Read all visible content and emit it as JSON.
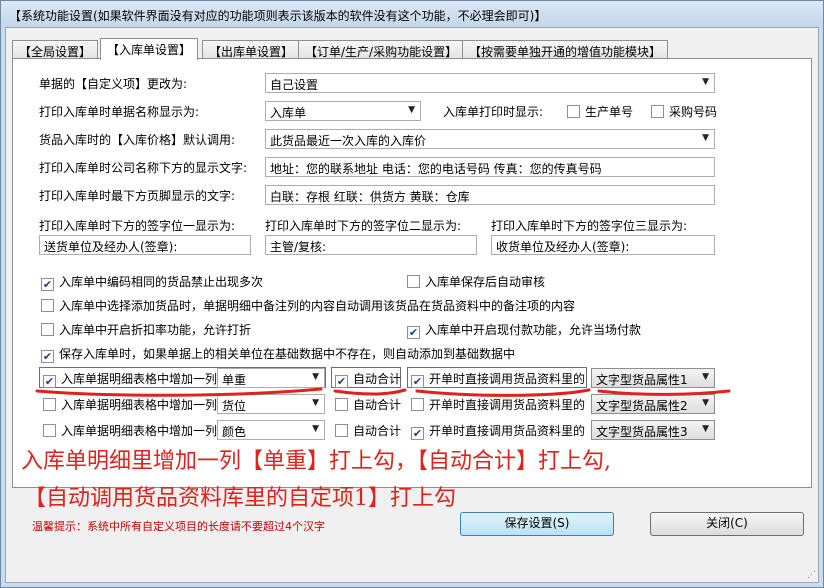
{
  "window": {
    "title": "【系统功能设置(如果软件界面没有对应的功能项则表示该版本的软件没有这个功能，不必理会即可)】"
  },
  "tabs": [
    {
      "label": "【全局设置】"
    },
    {
      "label": "【入库单设置】"
    },
    {
      "label": "【出库单设置】"
    },
    {
      "label": "【订单/生产/采购功能设置】"
    },
    {
      "label": "【按需要单独开通的增值功能模块】"
    }
  ],
  "form": {
    "custom_item_label": "单据的【自定义项】更改为:",
    "custom_item_value": "自己设置",
    "doc_name_label": "打印入库单时单据名称显示为:",
    "doc_name_value": "入库单",
    "print_show_label": "入库单打印时显示:",
    "production_no_label": "生产单号",
    "purchase_no_label": "采购号码",
    "price_default_label": "货品入库时的【入库价格】默认调用:",
    "price_default_value": "此货品最近一次入库的入库价",
    "company_text_label": "打印入库单时公司名称下方的显示文字:",
    "company_text_value": "地址：您的联系地址 电话：您的电话号码 传真：您的传真号码",
    "footer_text_label": "打印入库单时最下方页脚显示的文字:",
    "footer_text_value": "白联：存根   红联：供货方   黄联：仓库",
    "sign1_label": "打印入库单时下方的签字位一显示为:",
    "sign1_value": "送货单位及经办人(签章):",
    "sign2_label": "打印入库单时下方的签字位二显示为:",
    "sign2_value": "主管/复核:",
    "sign3_label": "打印入库单时下方的签字位三显示为:",
    "sign3_value": "收货单位及经办人(签章):"
  },
  "options": [
    {
      "label": "入库单中编码相同的货品禁止出现多次",
      "checked": true
    },
    {
      "label": "入库单保存后自动审核",
      "checked": false
    },
    {
      "label": "入库单中选择添加货品时，单据明细中备注列的内容自动调用该货品在货品资料中的备注项的内容",
      "checked": false
    },
    {
      "label": "入库单中开启折扣率功能，允许打折",
      "checked": false
    },
    {
      "label": "入库单中开启现付款功能，允许当场付款",
      "checked": true
    },
    {
      "label": "保存入库单时，如果单据上的相关单位在基础数据中不存在，则自动添加到基础数据中",
      "checked": true
    }
  ],
  "extra_columns": [
    {
      "label": "入库单据明细表格中增加一列",
      "checked": true,
      "column": "单重",
      "auto_sum_label": "自动合计",
      "auto_sum": true,
      "direct_label": "开单时直接调用货品资料里的",
      "direct": true,
      "attribute": "文字型货品属性1"
    },
    {
      "label": "入库单据明细表格中增加一列",
      "checked": false,
      "column": "货位",
      "auto_sum_label": "自动合计",
      "auto_sum": false,
      "direct_label": "开单时直接调用货品资料里的",
      "direct": false,
      "attribute": "文字型货品属性2"
    },
    {
      "label": "入库单据明细表格中增加一列",
      "checked": false,
      "column": "颜色",
      "auto_sum_label": "自动合计",
      "auto_sum": false,
      "direct_label": "开单时直接调用货品资料里的",
      "direct": true,
      "attribute": "文字型货品属性3"
    }
  ],
  "annotation": {
    "line1": "入库单明细里增加一列【单重】打上勾，【自动合计】打上勾,",
    "line2": "【自动调用货品资料库里的自定项1】打上勾"
  },
  "footer": {
    "tip": "温馨提示：系统中所有自定义项目的长度请不要超过4个汉字",
    "save_label": "保存设置(S)",
    "close_label": "关闭(C)"
  },
  "icons": {
    "dropdown": "chevron-down-icon",
    "check": "checkmark-icon",
    "grip": "resize-grip-icon"
  },
  "colors": {
    "annotation_red": "#e0221d",
    "tip_red": "#cc0000",
    "primary_button": "#b9e2f2",
    "window_frame": "#c9dbec"
  }
}
